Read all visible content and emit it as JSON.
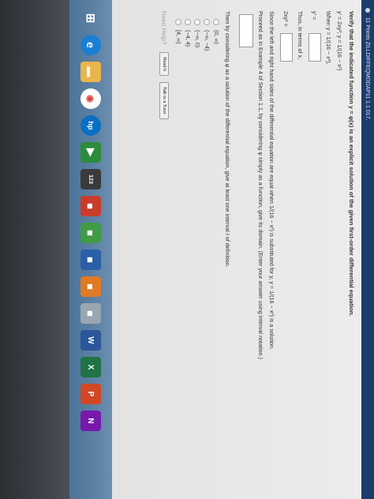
{
  "topbar": {
    "title": "11 Points  ZILLDIFFEQMODAP11 1.1.017."
  },
  "question": {
    "title": "Verify that the indicated function y = φ(x) is an explicit solution of the given first-order differential equation.",
    "equation": "y' = 2xy²;   y = 1/(16 − x²)",
    "when": "When y = 1/(16 − x²),",
    "yprime_label": "y' =",
    "thus": "Thus, in terms of x,",
    "twoxy_label": "2xy² =",
    "since": "Since the left and right hand sides of the differential equation are equal when 1/(16 − x²) is substituted for y, y = 1/(16 − x²) is a solution.",
    "proceed": "Proceed as in Example 4 of Section 1.1, by considering φ simply as a function, give its domain. (Enter your answer using interval notation.)",
    "then": "Then by considering φ as a solution of the differential equation, give at least one interval I of definition.",
    "options": [
      "(0, ∞)",
      "(−∞, −4)",
      "(−∞, 0)",
      "(−4, 4)",
      "[4, ∞)"
    ]
  },
  "help": {
    "label": "Need Help?",
    "read": "Read It",
    "talk": "Talk to a Tutor"
  },
  "taskbar": {
    "icons": [
      {
        "name": "windows-start-icon",
        "glyph": "⊞",
        "cls": "start"
      },
      {
        "name": "internet-explorer-icon",
        "glyph": "e",
        "cls": "ie"
      },
      {
        "name": "file-explorer-icon",
        "glyph": "▬",
        "cls": "folder"
      },
      {
        "name": "chrome-icon",
        "glyph": "◉",
        "cls": "chrome"
      },
      {
        "name": "hp-icon",
        "glyph": "hp",
        "cls": "hp"
      },
      {
        "name": "media-icon",
        "glyph": "▶",
        "cls": "media"
      },
      {
        "name": "calculator-icon",
        "glyph": "123",
        "cls": "nums"
      },
      {
        "name": "app-icon",
        "glyph": "■",
        "cls": "red"
      },
      {
        "name": "app-icon",
        "glyph": "■",
        "cls": "green"
      },
      {
        "name": "app-icon",
        "glyph": "■",
        "cls": "blue"
      },
      {
        "name": "app-icon",
        "glyph": "■",
        "cls": "orange"
      },
      {
        "name": "app-icon",
        "glyph": "■",
        "cls": "grey"
      },
      {
        "name": "word-icon",
        "glyph": "W",
        "cls": "word"
      },
      {
        "name": "excel-icon",
        "glyph": "X",
        "cls": "excel"
      },
      {
        "name": "powerpoint-icon",
        "glyph": "P",
        "cls": "pp"
      },
      {
        "name": "onenote-icon",
        "glyph": "N",
        "cls": "onenote"
      }
    ]
  }
}
